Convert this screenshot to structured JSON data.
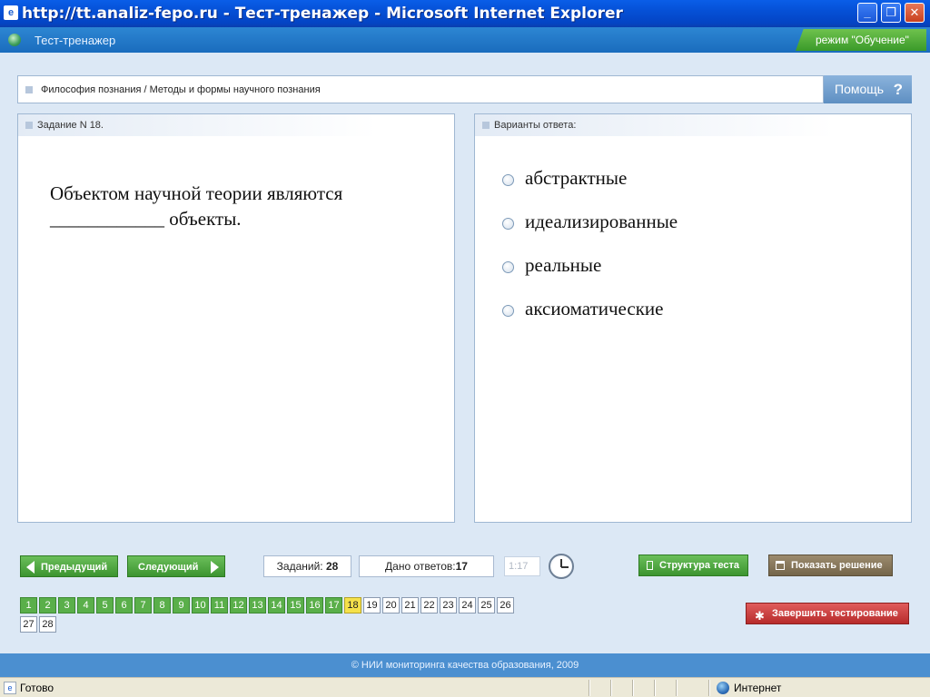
{
  "window": {
    "title": "http://tt.analiz-fepo.ru - Тест-тренажер - Microsoft Internet Explorer",
    "minimize": "_",
    "maximize": "❐",
    "close": "✕"
  },
  "header": {
    "app_title": "Тест-тренажер",
    "mode": "режим \"Обучение\""
  },
  "breadcrumb": "Философия познания / Методы и формы научного познания",
  "help": {
    "label": "Помощь",
    "icon": "?"
  },
  "task": {
    "heading": "Задание N 18.",
    "question": "Объектом научной теории являются ____________ объекты."
  },
  "answers": {
    "heading": "Варианты ответа:",
    "options": [
      "абстрактные",
      "идеализированные",
      "реальные",
      "аксиоматические"
    ]
  },
  "controls": {
    "prev": "Предыдущий",
    "next": "Следующий",
    "tasks_label": "Заданий:",
    "tasks_count": "28",
    "answered_label": "Дано ответов:",
    "answered_count": "17",
    "timer": "1:17",
    "structure": "Структура теста",
    "show_solution": "Показать решение",
    "finish": "Завершить тестирование"
  },
  "pager": {
    "pages": [
      "1",
      "2",
      "3",
      "4",
      "5",
      "6",
      "7",
      "8",
      "9",
      "10",
      "11",
      "12",
      "13",
      "14",
      "15",
      "16",
      "17",
      "18",
      "19",
      "20",
      "21",
      "22",
      "23",
      "24",
      "25",
      "26",
      "27",
      "28"
    ],
    "answered_through": 17,
    "current": 18
  },
  "footer": "© НИИ мониторинга качества образования, 2009",
  "statusbar": {
    "status": "Готово",
    "zone": "Интернет"
  },
  "colors": {
    "done": "#5aaf4a",
    "current": "#f5e14a",
    "todo": "#ffffff",
    "titlebar": "#0550d6"
  }
}
